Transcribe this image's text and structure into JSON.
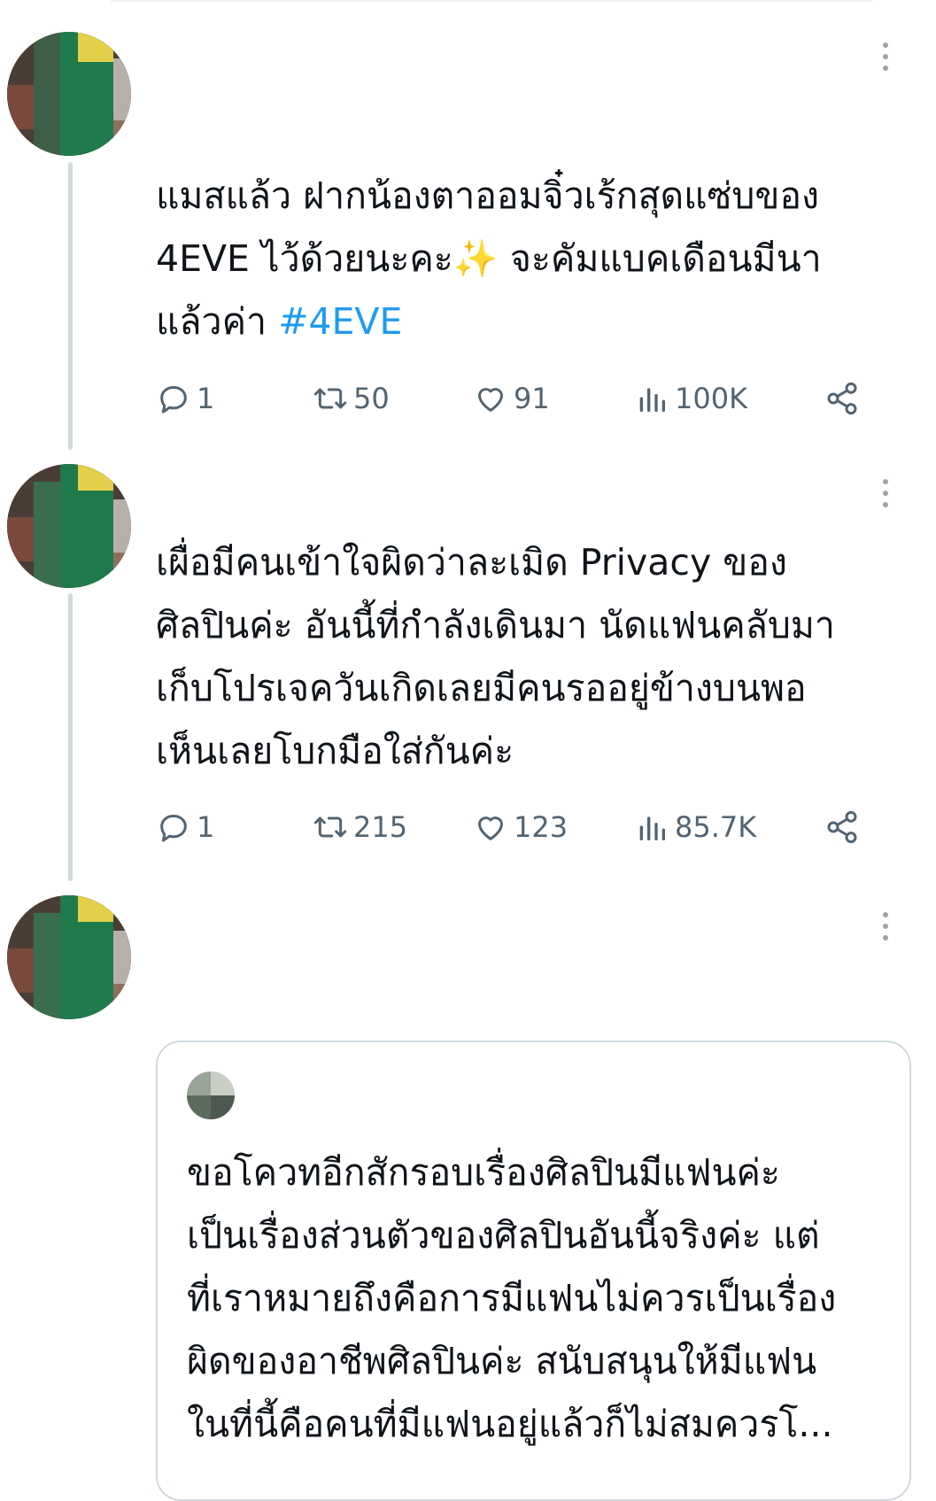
{
  "tweets": [
    {
      "text_main": "แมสแล้ว ฝากน้องตาออมจิ๋วเร้กสุดแซ่บของ\n4EVE ไว้ด้วยนะคะ✨ จะคัมแบคเดือนมีนา\nแล้วค่า ",
      "hashtag": "#4EVE",
      "replies": "1",
      "retweets": "50",
      "likes": "91",
      "views": "100K"
    },
    {
      "text_main": "เผื่อมีคนเข้าใจผิดว่าละเมิด Privacy ของ\nศิลปินค่ะ อันนี้ที่กำลังเดินมา นัดแฟนคลับมา\nเก็บโปรเจควันเกิดเลยมีคนรออยู่ข้างบนพอ\nเห็นเลยโบกมือใส่กันค่ะ",
      "replies": "1",
      "retweets": "215",
      "likes": "123",
      "views": "85.7K"
    }
  ],
  "quote": {
    "text": "ขอโควทอีกสักรอบเรื่องศิลปินมีแฟนค่ะ\nเป็นเรื่องส่วนตัวของศิลปินอันนี้จริงค่ะ แต่\nที่เราหมายถึงคือการมีแฟนไม่ควรเป็นเรื่อง\nผิดของอาชีพศิลปินค่ะ สนับสนุนให้มีแฟน\nในที่นี้คือคนที่มีแฟนอยู่แล้วก็ไม่สมควรโ..."
  },
  "icons": {
    "reply": "reply-icon",
    "retweet": "retweet-icon",
    "like": "heart-icon",
    "views": "views-icon",
    "share": "share-icon",
    "more": "more-icon"
  },
  "colors": {
    "hashtag": "#1d9bf0",
    "action": "#536471",
    "thread_line": "#cfd9de"
  }
}
